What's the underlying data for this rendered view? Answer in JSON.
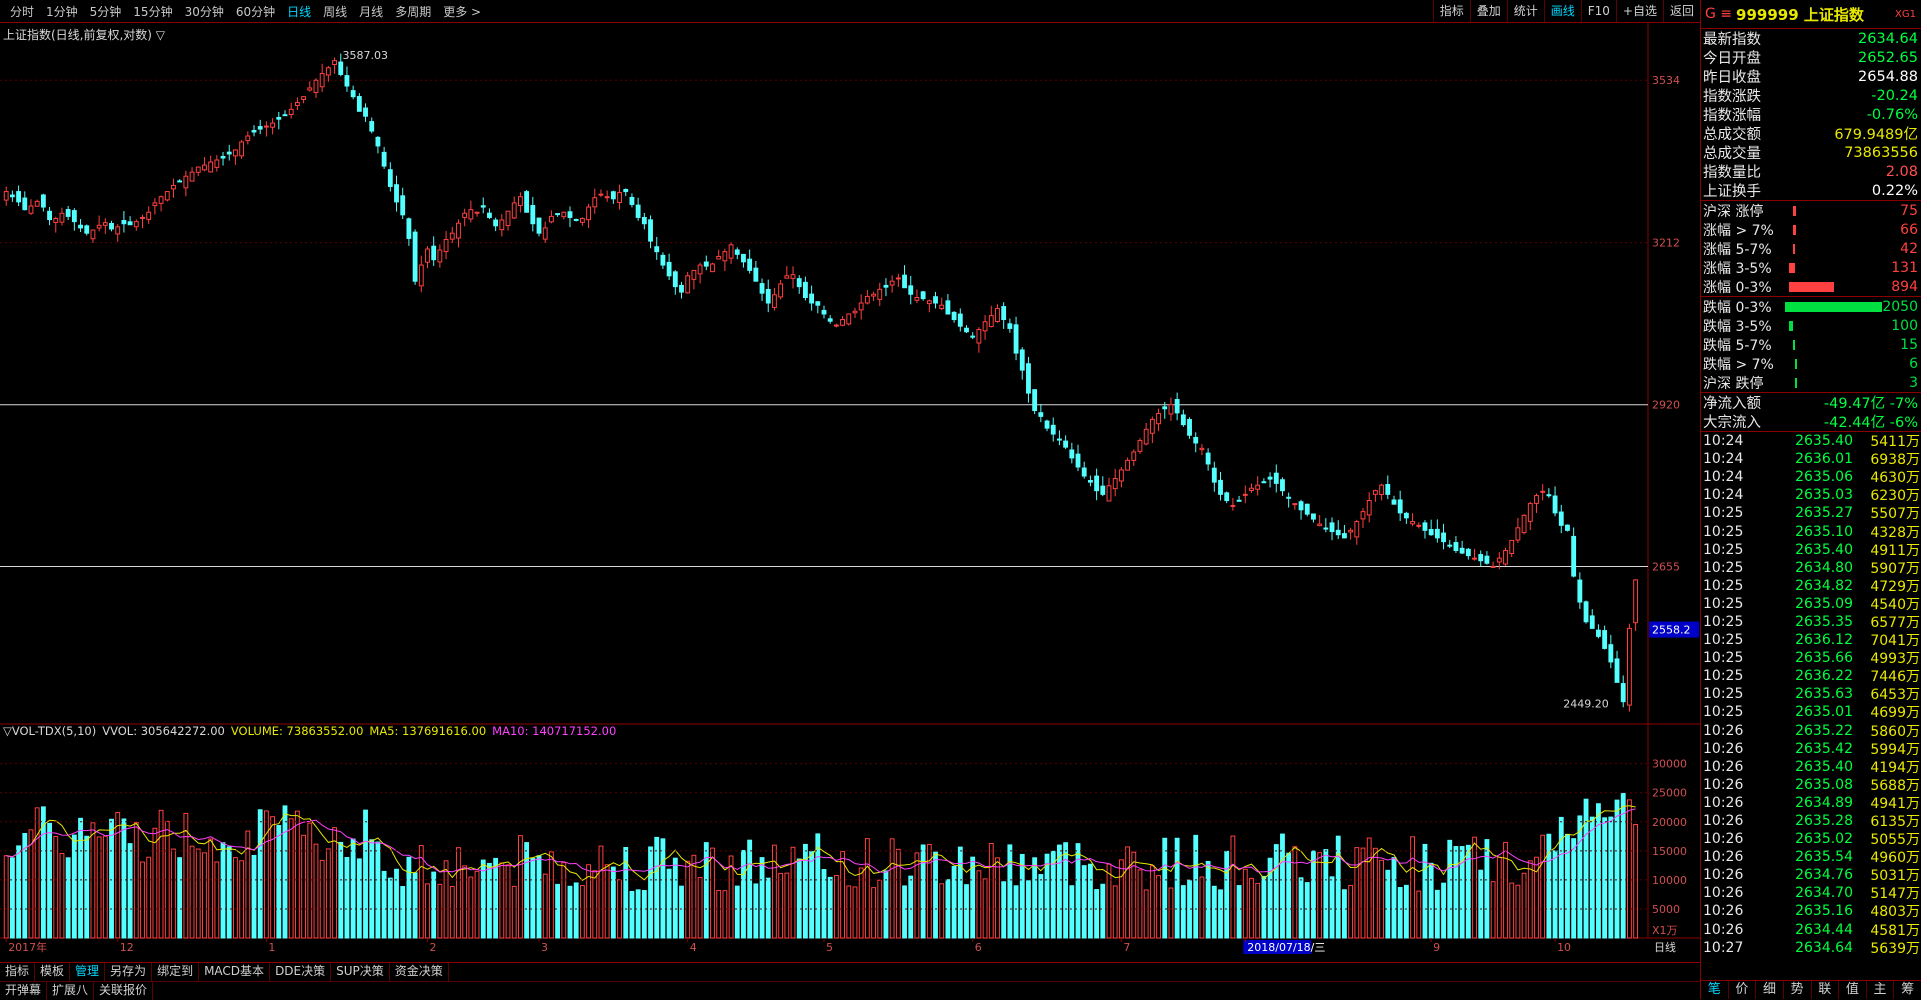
{
  "toolbar": {
    "periods": [
      "分时",
      "1分钟",
      "5分钟",
      "15分钟",
      "30分钟",
      "60分钟",
      "日线",
      "周线",
      "月线",
      "多周期",
      "更多 >"
    ],
    "active_period": "日线",
    "tools": [
      "指标",
      "叠加",
      "统计",
      "画线",
      "F10",
      "+自选",
      "返回"
    ],
    "active_tool": "画线"
  },
  "chart": {
    "title": "上证指数(日线,前复权,对数) ▽",
    "high_label": "3587.03",
    "low_label": "2449.20",
    "current_price_tag": "2558.2",
    "date_marker": "2018/07/18/三",
    "vol_unit": "X1万",
    "period_label": "日线"
  },
  "volume_header": {
    "name": "▽VOL-TDX(5,10)",
    "vvol": "VVOL: 305642272.00",
    "volume": "VOLUME: 73863552.00",
    "ma5": "MA5: 137691616.00",
    "ma10": "MA10: 140717152.00"
  },
  "chart_data": {
    "type": "candlestick",
    "y_scale": "log",
    "y_ticks": [
      3534,
      3212,
      2920,
      2655
    ],
    "y_range": [
      2420,
      3640
    ],
    "x_labels": [
      "2017年",
      "12",
      "1",
      "2",
      "3",
      "4",
      "5",
      "6",
      "7",
      "2018/07/18/三",
      "9",
      "10"
    ],
    "x_label_index": [
      0,
      18,
      42,
      68,
      86,
      110,
      132,
      156,
      180,
      200,
      230,
      250
    ],
    "closes": [
      3310,
      3300,
      3290,
      3275,
      3282,
      3291,
      3280,
      3256,
      3258,
      3268,
      3262,
      3252,
      3240,
      3230,
      3236,
      3245,
      3250,
      3238,
      3242,
      3248,
      3246,
      3252,
      3260,
      3270,
      3288,
      3300,
      3310,
      3322,
      3330,
      3340,
      3348,
      3358,
      3362,
      3368,
      3372,
      3376,
      3384,
      3392,
      3408,
      3420,
      3428,
      3434,
      3440,
      3446,
      3454,
      3462,
      3474,
      3488,
      3500,
      3518,
      3534,
      3548,
      3560,
      3575,
      3546,
      3522,
      3500,
      3470,
      3460,
      3430,
      3400,
      3360,
      3320,
      3290,
      3265,
      3220,
      3140,
      3170,
      3200,
      3180,
      3198,
      3218,
      3230,
      3249,
      3268,
      3275,
      3270,
      3280,
      3260,
      3244,
      3255,
      3272,
      3288,
      3300,
      3270,
      3248,
      3230,
      3240,
      3262,
      3266,
      3270,
      3260,
      3255,
      3258,
      3280,
      3298,
      3305,
      3300,
      3296,
      3308,
      3310,
      3285,
      3260,
      3248,
      3215,
      3195,
      3170,
      3150,
      3130,
      3120,
      3150,
      3160,
      3170,
      3168,
      3172,
      3186,
      3195,
      3208,
      3190,
      3176,
      3160,
      3140,
      3118,
      3100,
      3115,
      3135,
      3150,
      3152,
      3130,
      3110,
      3100,
      3096,
      3080,
      3067,
      3060,
      3070,
      3080,
      3085,
      3100,
      3112,
      3116,
      3125,
      3129,
      3140,
      3146,
      3128,
      3116,
      3110,
      3108,
      3104,
      3100,
      3096,
      3080,
      3070,
      3058,
      3048,
      3040,
      3052,
      3066,
      3077,
      3090,
      3070,
      3054,
      3010,
      2980,
      2940,
      2910,
      2900,
      2880,
      2870,
      2860,
      2848,
      2830,
      2815,
      2800,
      2790,
      2776,
      2770,
      2784,
      2796,
      2810,
      2826,
      2840,
      2859,
      2878,
      2895,
      2905,
      2913,
      2920,
      2906,
      2886,
      2868,
      2855,
      2846,
      2820,
      2790,
      2770,
      2760,
      2752,
      2760,
      2770,
      2780,
      2785,
      2790,
      2795,
      2788,
      2776,
      2764,
      2755,
      2745,
      2738,
      2730,
      2722,
      2715,
      2710,
      2705,
      2700,
      2712,
      2726,
      2742,
      2760,
      2776,
      2785,
      2770,
      2754,
      2740,
      2732,
      2726,
      2720,
      2712,
      2705,
      2700,
      2694,
      2688,
      2680,
      2676,
      2672,
      2668,
      2664,
      2660,
      2655,
      2668,
      2680,
      2696,
      2716,
      2736,
      2755,
      2768,
      2775,
      2768,
      2740,
      2720,
      2712,
      2640,
      2600,
      2570,
      2560,
      2548,
      2530,
      2510,
      2480,
      2452,
      2560,
      2634
    ],
    "volume_range": [
      0,
      32000
    ],
    "volume_ticks": [
      5000,
      10000,
      15000,
      20000,
      25000,
      30000
    ]
  },
  "panel": {
    "symbol_prefix": "G ≡",
    "symbol": "999999 上证指数",
    "tag": "XG1",
    "quotes": [
      {
        "label": "最新指数",
        "value": "2634.64",
        "color": "#00ff40"
      },
      {
        "label": "今日开盘",
        "value": "2652.65",
        "color": "#00ff40"
      },
      {
        "label": "昨日收盘",
        "value": "2654.88",
        "color": "#ffffff"
      },
      {
        "label": "指数涨跌",
        "value": "-20.24",
        "color": "#00ff40"
      },
      {
        "label": "指数涨幅",
        "value": "-0.76%",
        "color": "#00ff40"
      },
      {
        "label": "总成交额",
        "value": "679.9489亿",
        "color": "#e8e800"
      },
      {
        "label": "总成交量",
        "value": "73863556",
        "color": "#e8e800"
      },
      {
        "label": "指数量比",
        "value": "2.08",
        "color": "#ff5050"
      },
      {
        "label": "上证换手",
        "value": "0.22%",
        "color": "#ffffff"
      }
    ],
    "breadth_up": [
      {
        "label": "沪深 涨停",
        "value": "75",
        "bar": 0.02
      },
      {
        "label": "涨幅 > 7%",
        "value": "66",
        "bar": 0.02
      },
      {
        "label": "涨幅 5-7%",
        "value": "42",
        "bar": 0.01
      },
      {
        "label": "涨幅 3-5%",
        "value": "131",
        "bar": 0.04
      },
      {
        "label": "涨幅 0-3%",
        "value": "894",
        "bar": 0.3
      }
    ],
    "breadth_down": [
      {
        "label": "跌幅 0-3%",
        "value": "2050",
        "bar": 0.65
      },
      {
        "label": "跌幅 3-5%",
        "value": "100",
        "bar": 0.03
      },
      {
        "label": "跌幅 5-7%",
        "value": "15",
        "bar": 0.01
      },
      {
        "label": "跌幅 > 7%",
        "value": "6",
        "bar": 0.01
      },
      {
        "label": "沪深 跌停",
        "value": "3",
        "bar": 0.01
      }
    ],
    "flows": [
      {
        "label": "净流入额",
        "value": "-49.47亿 -7%"
      },
      {
        "label": "大宗流入",
        "value": "-42.44亿 -6%"
      }
    ],
    "ticks": [
      [
        "10:24",
        "2635.40",
        "5411万"
      ],
      [
        "10:24",
        "2636.01",
        "6938万"
      ],
      [
        "10:24",
        "2635.06",
        "4630万"
      ],
      [
        "10:24",
        "2635.03",
        "6230万"
      ],
      [
        "10:25",
        "2635.27",
        "5507万"
      ],
      [
        "10:25",
        "2635.10",
        "4328万"
      ],
      [
        "10:25",
        "2635.40",
        "4911万"
      ],
      [
        "10:25",
        "2634.80",
        "5907万"
      ],
      [
        "10:25",
        "2634.82",
        "4729万"
      ],
      [
        "10:25",
        "2635.09",
        "4540万"
      ],
      [
        "10:25",
        "2635.35",
        "6577万"
      ],
      [
        "10:25",
        "2636.12",
        "7041万"
      ],
      [
        "10:25",
        "2635.66",
        "4993万"
      ],
      [
        "10:25",
        "2636.22",
        "7446万"
      ],
      [
        "10:25",
        "2635.63",
        "6453万"
      ],
      [
        "10:25",
        "2635.01",
        "4699万"
      ],
      [
        "10:26",
        "2635.22",
        "5860万"
      ],
      [
        "10:26",
        "2635.42",
        "5994万"
      ],
      [
        "10:26",
        "2635.40",
        "4194万"
      ],
      [
        "10:26",
        "2635.08",
        "5688万"
      ],
      [
        "10:26",
        "2634.89",
        "4941万"
      ],
      [
        "10:26",
        "2635.28",
        "6135万"
      ],
      [
        "10:26",
        "2635.02",
        "5055万"
      ],
      [
        "10:26",
        "2635.54",
        "4960万"
      ],
      [
        "10:26",
        "2634.76",
        "5031万"
      ],
      [
        "10:26",
        "2634.70",
        "5147万"
      ],
      [
        "10:26",
        "2635.16",
        "4803万"
      ],
      [
        "10:26",
        "2634.44",
        "4581万"
      ],
      [
        "10:27",
        "2634.64",
        "5639万"
      ]
    ],
    "footer_tabs": [
      "笔",
      "价",
      "细",
      "势",
      "联",
      "值",
      "主",
      "筹"
    ]
  },
  "bottom_tabs": [
    "指标",
    "模板",
    "管理",
    "另存为",
    "绑定到",
    "MACD基本",
    "DDE决策",
    "SUP决策",
    "资金决策"
  ],
  "active_bottom_tab": "管理",
  "bottom_tabs2": [
    "开弹幕",
    "扩展八",
    "关联报价"
  ]
}
